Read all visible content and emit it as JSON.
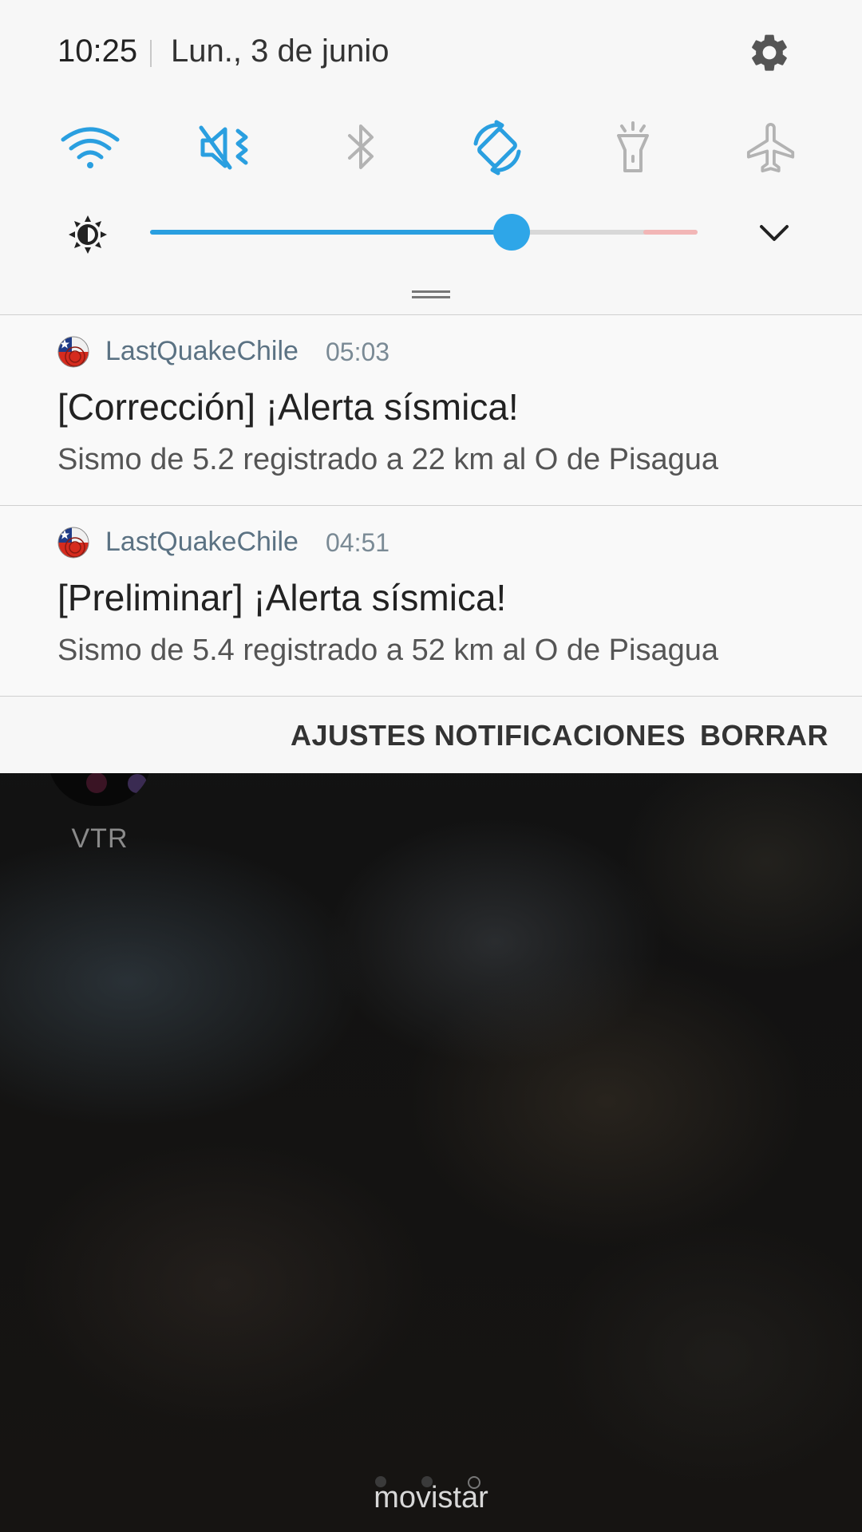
{
  "status": {
    "time": "10:25",
    "date": "Lun., 3 de junio"
  },
  "quick_settings": [
    {
      "name": "wifi",
      "active": true
    },
    {
      "name": "sound-mute-vibrate",
      "active": true
    },
    {
      "name": "bluetooth",
      "active": false
    },
    {
      "name": "auto-rotate",
      "active": true
    },
    {
      "name": "flashlight",
      "active": false
    },
    {
      "name": "airplane-mode",
      "active": false
    }
  ],
  "brightness": {
    "level": 0.66
  },
  "notifications": [
    {
      "app": "LastQuakeChile",
      "time": "05:03",
      "title": "[Corrección] ¡Alerta sísmica!",
      "body": "Sismo de 5.2 registrado a 22 km al O de Pisagua"
    },
    {
      "app": "LastQuakeChile",
      "time": "04:51",
      "title": "[Preliminar] ¡Alerta sísmica!",
      "body": "Sismo de 5.4 registrado a 52 km al O de Pisagua"
    }
  ],
  "actions": {
    "settings": "AJUSTES NOTIFICACIONES",
    "clear": "BORRAR"
  },
  "home": {
    "app_label": "VTR",
    "carrier": "movistar"
  },
  "colors": {
    "accent": "#2a9fe0",
    "inactive": "#b3b3b3",
    "panel": "#f7f7f7"
  }
}
